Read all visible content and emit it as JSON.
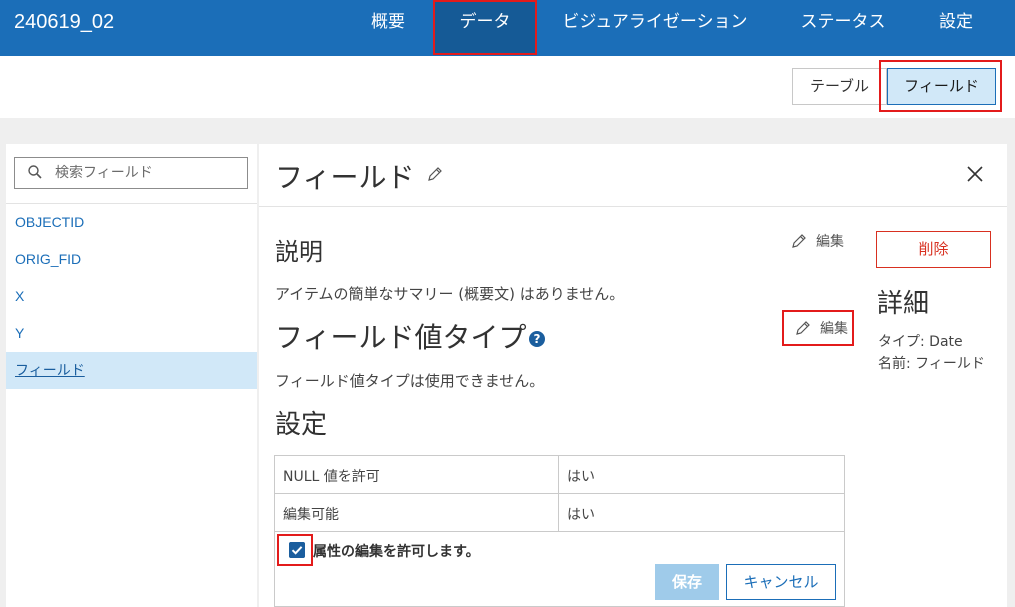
{
  "header": {
    "title": "240619_02",
    "nav": [
      "概要",
      "データ",
      "ビジュアライゼーション",
      "ステータス",
      "設定"
    ]
  },
  "subheader": {
    "table_label": "テーブル",
    "field_label": "フィールド"
  },
  "fields_panel": {
    "search_placeholder": "検索フィールド",
    "items": [
      "OBJECTID",
      "ORIG_FID",
      "X",
      "Y",
      "フィールド"
    ]
  },
  "field_panel": {
    "title": "フィールド",
    "description": {
      "heading": "説明",
      "edit_label": "編集",
      "text": "アイテムの簡単なサマリー (概要文) はありません。"
    },
    "value_type": {
      "heading": "フィールド値タイプ",
      "help_glyph": "?",
      "edit_label": "編集",
      "text": "フィールド値タイプは使用できません。"
    },
    "settings": {
      "heading": "設定",
      "rows": [
        {
          "key": "NULL 値を許可",
          "value": "はい"
        },
        {
          "key": "編集可能",
          "value": "はい"
        }
      ],
      "checkbox_label": "属性の編集を許可します。",
      "checkbox_checked": true,
      "save_label": "保存",
      "cancel_label": "キャンセル"
    },
    "delete_label": "削除",
    "details": {
      "heading": "詳細",
      "type_line": "タイプ: Date",
      "name_line": "名前: フィールド"
    }
  },
  "colors": {
    "header_bg": "#1b6eb8",
    "accent": "#1b6eb8",
    "highlight_red": "#e31b1b",
    "danger": "#d83020",
    "selected_bg": "#d1e8f8"
  }
}
